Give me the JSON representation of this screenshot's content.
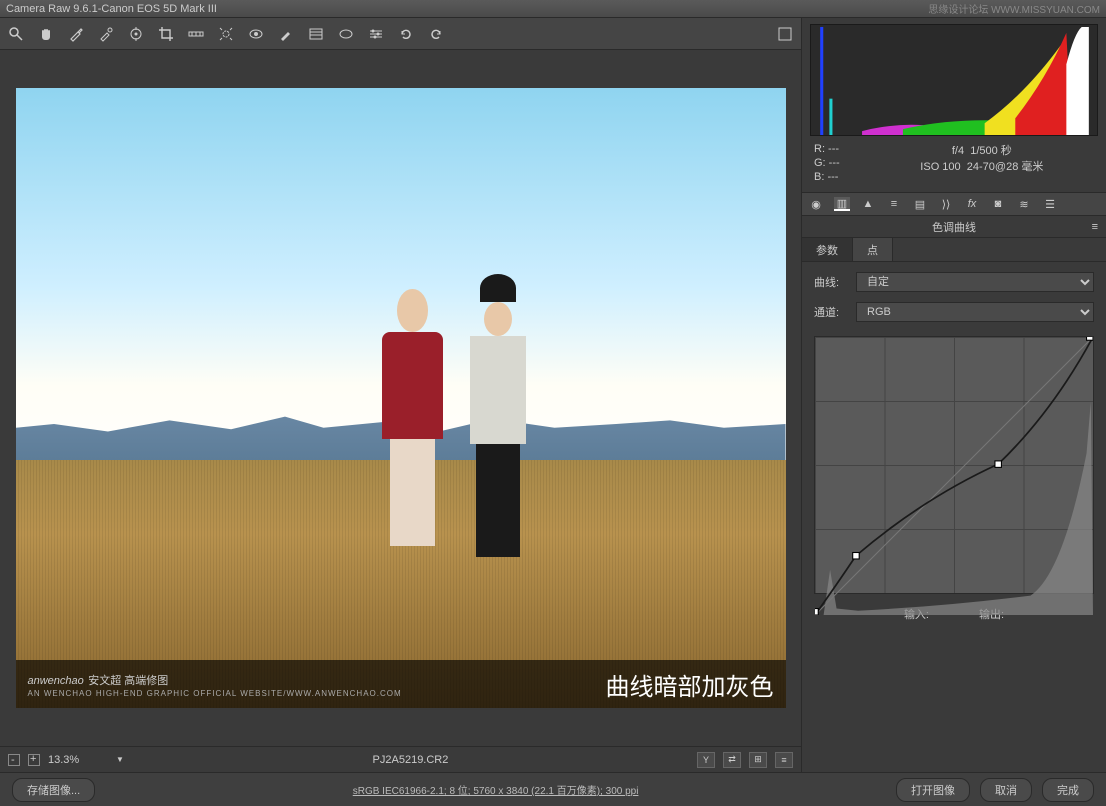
{
  "titlebar": {
    "app": "Camera Raw 9.6.1",
    "sep": " - ",
    "camera": "Canon EOS 5D Mark III",
    "watermark": "思缘设计论坛 WWW.MISSYUAN.COM"
  },
  "toolbar_icons": [
    "zoom",
    "hand",
    "eyedropper",
    "color-sampler",
    "target-adjust",
    "crop",
    "straighten",
    "spot-removal",
    "redeye",
    "adjustment-brush",
    "graduated-filter",
    "radial-filter",
    "prefs",
    "rotate-ccw",
    "rotate-cw"
  ],
  "preview": {
    "overlay_logo": "anwenchao",
    "overlay_logo_cn": "安文超 高端修图",
    "overlay_logo_sub": "AN WENCHAO HIGH-END GRAPHIC OFFICIAL WEBSITE/WWW.ANWENCHAO.COM",
    "caption": "曲线暗部加灰色"
  },
  "statusbar": {
    "zoom": "13.3%",
    "filename": "PJ2A5219.CR2"
  },
  "exif": {
    "r": "R: ---",
    "g": "G: ---",
    "b": "B: ---",
    "aperture": "f/4",
    "shutter": "1/500 秒",
    "iso": "ISO 100",
    "lens": "24-70@28 毫米"
  },
  "panel_title": "色调曲线",
  "subtabs": {
    "params": "参数",
    "point": "点"
  },
  "curve": {
    "label": "曲线:",
    "value": "自定"
  },
  "channel": {
    "label": "通道:",
    "value": "RGB"
  },
  "curve_io": {
    "input": "输入:",
    "output": "输出:"
  },
  "footer": {
    "save": "存储图像...",
    "meta": "sRGB IEC61966-2.1; 8 位; 5760 x 3840 (22.1 百万像素); 300 ppi",
    "open": "打开图像",
    "cancel": "取消",
    "done": "完成"
  },
  "chart_data": {
    "histogram": {
      "type": "area",
      "note": "RGB luminosity histogram",
      "x_range": [
        0,
        255
      ],
      "channels": {
        "blue_spike": {
          "x": 10,
          "h": 100
        },
        "cyan_spike": {
          "x": 18,
          "h": 35
        },
        "magenta": {
          "x": [
            50,
            110
          ],
          "h": [
            8,
            14
          ]
        },
        "green": {
          "x": [
            90,
            200
          ],
          "h": [
            10,
            25
          ]
        },
        "yellow": {
          "x": [
            170,
            245
          ],
          "h": [
            15,
            85
          ]
        },
        "red": {
          "x": [
            200,
            250
          ],
          "h": [
            20,
            95
          ]
        },
        "white": {
          "x": [
            248,
            255
          ],
          "h": [
            70,
            100
          ]
        }
      }
    },
    "curve": {
      "type": "line",
      "xlabel": "输入",
      "ylabel": "输出",
      "xlim": [
        0,
        255
      ],
      "ylim": [
        0,
        255
      ],
      "points": [
        {
          "x": 0,
          "y": 0
        },
        {
          "x": 38,
          "y": 55
        },
        {
          "x": 170,
          "y": 140
        },
        {
          "x": 255,
          "y": 255
        }
      ],
      "background_hist": {
        "spike_at": 14,
        "spike_h": 42,
        "tail_start": 200,
        "tail_h": 150
      }
    }
  }
}
